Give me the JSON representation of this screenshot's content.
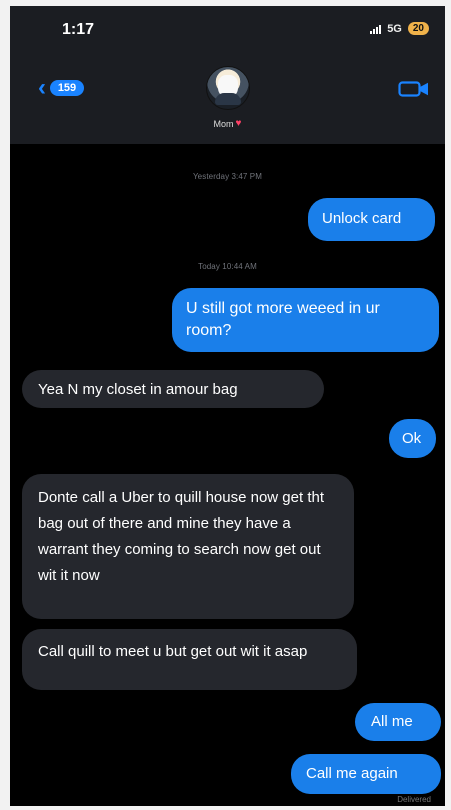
{
  "status": {
    "time": "1:17",
    "network": "5G",
    "battery": "20"
  },
  "header": {
    "back_count": "159",
    "contact_name": "Mom"
  },
  "messages": {
    "timestamp_1": "Yesterday 3:47 PM",
    "timestamp_2": "Today 10:44 AM",
    "items": [
      "Unlock card",
      "U still got more weeed in ur room?",
      "Yea N my closet in amour bag",
      "Ok",
      "Donte call a Uber to quill house now get tht bag out of there and mine they have a warrant they coming to search now get out wit it now",
      "Call quill to meet u but get out wit it asap",
      "All me",
      "Call me again"
    ],
    "delivered": "Delivered"
  },
  "colors": {
    "accent": "#1a7fea",
    "incoming_bubble": "#25272d",
    "header_background": "#1b1d22",
    "heart": "#ff4066"
  },
  "icons": {
    "back": "chevron-left-icon",
    "video": "video-call-icon",
    "heart": "heart-icon",
    "signal": "cellular-signal-icon"
  }
}
